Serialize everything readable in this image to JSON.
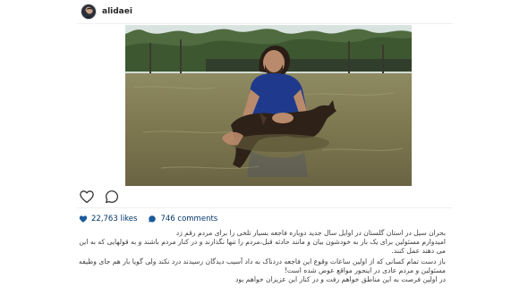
{
  "post": {
    "username": "alidaei",
    "likes_count": "22,763",
    "likes_label": "likes",
    "comments_count": "746",
    "comments_label": "comments",
    "caption_lines": [
      "بحران سیل در استان گلستان در اوایل سال جدید دوباره فاجعه بسیار تلخی را برای مردم رقم زد",
      "امیدوارم مسئولین برای یک بار به خودشون بیان و مانند حادثه قبل،مردم را تنها نگذارند و در کنار مردم باشند و به قولهایی که به این مردم",
      "می دهند عمل کنند.",
      "باز دست تمام کسانی که از اولین ساعات وقوع این فاجعه دردناک به داد آسیب دیدگان رسیدند درد نکند ولی گویا بار هم جای وظیفه",
      "مسئولین و مردم عادی در اینجور مواقع عوض شده است!",
      "در اولین فرصت به این مناطق خواهم رفت و در کنار این عزیزان خواهم بود"
    ]
  },
  "icons": {
    "avatar": "profile-avatar",
    "photo": "man-holding-animal-in-flood-photo",
    "like": "heart-outline-icon",
    "comment": "speech-bubble-outline-icon",
    "likes_stat": "heart-filled-icon",
    "comments_stat": "speech-bubble-filled-icon"
  },
  "colors": {
    "link_blue": "#003569",
    "text": "#262626",
    "divider": "#efefef"
  }
}
